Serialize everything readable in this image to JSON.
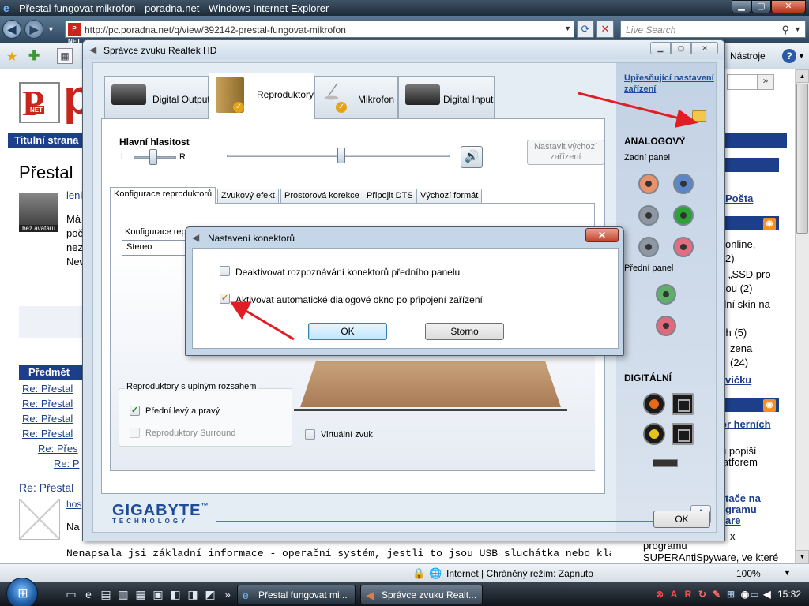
{
  "ie": {
    "window_title": "Přestal fungovat mikrofon - poradna.net - Windows Internet Explorer",
    "url": "http://pc.poradna.net/q/view/392142-prestal-fungovat-mikrofon",
    "favicon_text": "P NET",
    "search_placeholder": "Live Search",
    "tools_menu": "Nástroje",
    "status_text": "Internet | Chráněný režim: Zapnuto",
    "zoom": "100%"
  },
  "page": {
    "logo_text": "P",
    "logo_net": "NET",
    "big_logo": "p",
    "nav_first": "Titulní strana",
    "heading": "Přestal",
    "avatar_label": "bez avataru",
    "author": "lenk",
    "lead_lines": [
      "Má",
      "poč",
      "nez",
      "New"
    ],
    "thread_header": "Předmět",
    "thread_links": [
      "Re: Přestal",
      "Re: Přestal",
      "Re: Přestal",
      "Re: Přestal",
      "Re: Přes",
      "Re: P"
    ],
    "reply_header": "Re: Přestal",
    "reply_author": "hos",
    "reply_na": "Na",
    "bottom_line": "Nenapsala jsi základní informace - operační systém, jestli to jsou USB sluchátka nebo klasická, atd...",
    "right_col": {
      "search_btn": "»",
      "posta": "Pošta",
      "online": "online,",
      "online_count": "2)",
      "ssd": "s „SSD pro",
      "ssd2": "kou (2)",
      "skin": "dní skin na",
      "ch5": "ch (5)",
      "zena": "zena",
      "n24": "(24)",
      "vicku": "vičku",
      "hernich": "or herních",
      "popisi": "u popiší",
      "platforem": "latforem",
      "tace": "tače na",
      "gramu": "gramu",
      "are": "are",
      "x": "x",
      "programu": "programu",
      "superanti": "SUPERAntiSpyware, ve které"
    }
  },
  "taskbar": {
    "task_ie": "Přestal fungovat mi...",
    "task_realtek": "Správce zvuku Realt...",
    "clock": "15:32"
  },
  "realtek": {
    "title": "Správce zvuku Realtek HD",
    "tabs": [
      "Digital Output",
      "Reproduktory",
      "Mikrofon",
      "Digital Input"
    ],
    "main_volume_label": "Hlavní hlasitost",
    "left": "L",
    "right": "R",
    "set_default": "Nastavit výchozí zařízení",
    "subtabs": [
      "Konfigurace reproduktorů",
      "Zvukový efekt",
      "Prostorová korekce",
      "Připojit DTS",
      "Výchozí formát"
    ],
    "speaker_config_label": "Konfigurace reproduktorů",
    "speaker_config_value": "Stereo",
    "full_range_label": "Reproduktory s úplným rozsahem",
    "front_lr": "Přední levý a pravý",
    "surround": "Reproduktory Surround",
    "virtual_sound": "Virtuální zvuk",
    "adv_link": "Upřesňující nastavení zařízení",
    "analog": "ANALOGOVÝ",
    "rear_panel": "Zadní panel",
    "front_panel": "Přední panel",
    "digital": "DIGITÁLNÍ",
    "logo": "GIGABYTE",
    "logo_tm": "™",
    "logo_sub": "TECHNOLOGY",
    "info": "i",
    "ok": "OK"
  },
  "dialog": {
    "title": "Nastavení konektorů",
    "option1": "Deaktivovat rozpoznávání konektorů předního panelu",
    "option1_checked": false,
    "option2": "Aktivovat automatické dialogové okno po připojení zařízení",
    "option2_checked": true,
    "ok": "OK",
    "cancel": "Storno"
  },
  "jack_colors": {
    "orange": "#e9926a",
    "blue": "#5b86c9",
    "grey": "#8f98a2",
    "green": "#2aa334",
    "pink": "#e46d80",
    "front_green": "#5fae6a",
    "front_pink": "#e06a7c",
    "accent_red": "#e11d25"
  }
}
